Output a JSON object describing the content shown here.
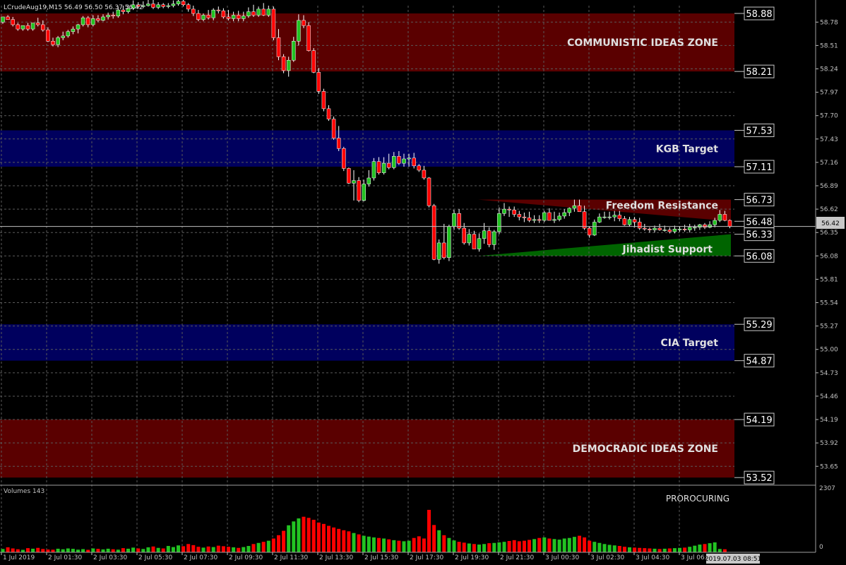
{
  "header": {
    "symbol_info": "LCrudeAug19,M15  56.49 56.50 56.37 56.42"
  },
  "colors": {
    "background": "#000000",
    "grid": "#5a5a5a",
    "bull": "#22c322",
    "bear": "#ff0000",
    "wick": "#ffffff",
    "red_zone": "#5a0000",
    "blue_zone": "#00005e",
    "triangle_red": "#5a0000",
    "triangle_green": "#006400",
    "text_light": "#e0e0e0",
    "price_box_border": "#c8c8c8"
  },
  "volume_panel": {
    "label": "Volumes 143",
    "indicator_label": "PROROCURING",
    "scale_top": "2307",
    "scale_bottom": "0"
  },
  "current_price_tag": "56.42",
  "timestamp_tag": "2019.07.03 08:51",
  "chart_data": {
    "type": "candlestick",
    "symbol": "LCrudeAug19",
    "timeframe": "M15",
    "ylim": [
      53.44,
      58.97
    ],
    "y_ticks": [
      "58.78",
      "58.51",
      "58.24",
      "57.97",
      "57.70",
      "57.43",
      "57.16",
      "56.89",
      "56.62",
      "56.35",
      "56.08",
      "55.81",
      "55.54",
      "55.27",
      "55.00",
      "54.73",
      "54.46",
      "54.19",
      "53.92",
      "53.65"
    ],
    "x_ticks": [
      "1 Jul 2019",
      "2 Jul 01:30",
      "2 Jul 03:30",
      "2 Jul 05:30",
      "2 Jul 07:30",
      "2 Jul 09:30",
      "2 Jul 11:30",
      "2 Jul 13:30",
      "2 Jul 15:30",
      "2 Jul 17:30",
      "2 Jul 19:30",
      "2 Jul 21:30",
      "3 Jul 00:30",
      "3 Jul 02:30",
      "3 Jul 04:30",
      "3 Jul 06:30"
    ],
    "candles": {
      "opens": [
        58.78,
        58.84,
        58.81,
        58.75,
        58.7,
        58.74,
        58.7,
        58.77,
        58.75,
        58.69,
        58.56,
        58.52,
        58.6,
        58.62,
        58.67,
        58.7,
        58.75,
        58.83,
        58.75,
        58.82,
        58.8,
        58.84,
        58.86,
        58.85,
        58.92,
        58.9,
        58.94,
        58.98,
        58.96,
        58.97,
        58.99,
        58.95,
        58.98,
        58.96,
        58.97,
        58.99,
        59.02,
        58.98,
        58.93,
        58.88,
        58.81,
        58.86,
        58.83,
        58.92,
        58.91,
        58.84,
        58.82,
        58.86,
        58.82,
        58.85,
        58.9,
        58.86,
        58.93,
        58.86,
        58.93,
        58.6,
        58.38,
        58.22,
        58.34,
        58.56,
        58.8,
        58.74,
        58.45,
        58.2,
        57.98,
        57.78,
        57.66,
        57.44,
        57.32,
        57.09,
        56.92,
        56.95,
        56.72,
        56.91,
        56.98,
        57.17,
        57.04,
        57.15,
        57.1,
        57.23,
        57.15,
        57.2,
        57.21,
        57.12,
        57.07,
        56.98,
        56.66,
        56.04,
        56.23,
        56.06,
        56.42,
        56.57,
        56.4,
        56.23,
        56.33,
        56.16,
        56.28,
        56.37,
        56.21,
        56.36,
        56.57,
        56.62,
        56.61,
        56.56,
        56.53,
        56.52,
        56.49,
        56.5,
        56.49,
        56.58,
        56.49,
        56.5,
        56.54,
        56.58,
        56.63,
        56.66,
        56.59,
        56.4,
        56.32,
        56.47,
        56.53,
        56.53,
        56.53,
        56.55,
        56.51,
        56.44,
        56.5,
        56.47,
        56.4,
        56.39,
        56.38,
        56.4,
        56.38,
        56.38,
        56.36,
        56.39,
        56.39,
        56.38,
        56.41,
        56.41,
        56.44,
        56.41,
        56.44,
        56.49,
        56.56,
        56.49
      ],
      "highs": [
        58.81,
        58.86,
        58.84,
        58.77,
        58.73,
        58.77,
        58.74,
        58.83,
        58.8,
        58.72,
        58.6,
        58.62,
        58.67,
        58.69,
        58.73,
        58.76,
        58.85,
        58.85,
        58.86,
        58.86,
        58.87,
        58.89,
        58.9,
        58.96,
        58.97,
        58.98,
        59.03,
        59.01,
        59.02,
        59.05,
        59.04,
        59.01,
        59.0,
        59.0,
        59.03,
        59.05,
        59.06,
        59.0,
        58.97,
        58.92,
        58.88,
        58.92,
        58.94,
        58.96,
        58.94,
        58.92,
        58.9,
        58.91,
        58.9,
        58.95,
        58.98,
        58.96,
        59.0,
        58.97,
        58.96,
        58.7,
        58.41,
        58.38,
        58.61,
        58.87,
        58.86,
        58.78,
        58.48,
        58.25,
        58.01,
        57.82,
        57.69,
        57.58,
        57.34,
        57.1,
        57.07,
        56.99,
        56.96,
        57.07,
        57.21,
        57.22,
        57.22,
        57.26,
        57.28,
        57.29,
        57.26,
        57.26,
        57.27,
        57.14,
        57.12,
        56.99,
        56.68,
        56.27,
        56.45,
        56.44,
        56.61,
        56.62,
        56.46,
        56.39,
        56.37,
        56.34,
        56.46,
        56.41,
        56.38,
        56.64,
        56.69,
        56.65,
        56.65,
        56.6,
        56.58,
        56.59,
        56.55,
        56.55,
        56.6,
        56.63,
        56.59,
        56.58,
        56.62,
        56.64,
        56.73,
        56.73,
        56.66,
        56.42,
        56.5,
        56.57,
        56.59,
        56.59,
        56.6,
        56.6,
        56.54,
        56.53,
        56.53,
        56.52,
        56.45,
        56.41,
        56.43,
        56.45,
        56.43,
        56.41,
        56.43,
        56.42,
        56.44,
        56.45,
        56.44,
        56.45,
        56.46,
        56.48,
        56.52,
        56.61,
        56.6,
        56.5
      ],
      "lows": [
        58.76,
        58.81,
        58.73,
        58.68,
        58.68,
        58.68,
        58.68,
        58.73,
        58.67,
        58.55,
        58.5,
        58.49,
        58.57,
        58.6,
        58.64,
        58.65,
        58.73,
        58.72,
        58.73,
        58.78,
        58.79,
        58.81,
        58.82,
        58.83,
        58.87,
        58.88,
        58.92,
        58.94,
        58.94,
        58.96,
        58.93,
        58.93,
        58.94,
        58.94,
        58.95,
        58.97,
        58.96,
        58.9,
        58.85,
        58.79,
        58.79,
        58.81,
        58.8,
        58.88,
        58.82,
        58.8,
        58.79,
        58.79,
        58.79,
        58.83,
        58.84,
        58.84,
        58.85,
        58.84,
        58.57,
        58.34,
        58.19,
        58.15,
        58.32,
        58.51,
        58.71,
        58.44,
        58.19,
        57.95,
        57.75,
        57.64,
        57.42,
        57.29,
        57.06,
        56.91,
        56.72,
        56.7,
        56.71,
        56.88,
        56.95,
        57.02,
        57.02,
        57.08,
        57.08,
        57.13,
        57.11,
        57.11,
        57.09,
        57.05,
        56.96,
        56.64,
        56.03,
        55.99,
        56.04,
        56.02,
        56.38,
        56.38,
        56.21,
        56.2,
        56.16,
        56.13,
        56.22,
        56.18,
        56.15,
        56.33,
        56.54,
        56.53,
        56.53,
        56.49,
        56.47,
        56.47,
        56.46,
        56.46,
        56.47,
        56.49,
        56.46,
        56.48,
        56.51,
        56.54,
        56.59,
        56.59,
        56.38,
        56.29,
        56.31,
        56.46,
        56.51,
        56.5,
        56.48,
        56.48,
        56.43,
        56.42,
        56.41,
        56.38,
        56.37,
        56.35,
        56.35,
        56.37,
        56.36,
        56.34,
        56.34,
        56.36,
        56.36,
        56.35,
        56.37,
        56.38,
        56.39,
        56.4,
        56.41,
        56.47,
        56.48,
        56.4
      ],
      "closes": [
        58.84,
        58.81,
        58.75,
        58.7,
        58.74,
        58.7,
        58.77,
        58.75,
        58.69,
        58.56,
        58.52,
        58.6,
        58.62,
        58.67,
        58.7,
        58.75,
        58.83,
        58.75,
        58.82,
        58.8,
        58.84,
        58.86,
        58.85,
        58.92,
        58.9,
        58.94,
        58.98,
        58.96,
        58.97,
        58.99,
        58.95,
        58.98,
        58.96,
        58.97,
        58.99,
        59.02,
        58.98,
        58.93,
        58.88,
        58.81,
        58.86,
        58.83,
        58.92,
        58.91,
        58.84,
        58.82,
        58.86,
        58.82,
        58.85,
        58.9,
        58.86,
        58.93,
        58.86,
        58.93,
        58.6,
        58.38,
        58.22,
        58.34,
        58.56,
        58.8,
        58.74,
        58.45,
        58.2,
        57.98,
        57.78,
        57.66,
        57.44,
        57.32,
        57.09,
        56.92,
        56.95,
        56.72,
        56.91,
        56.98,
        57.17,
        57.04,
        57.15,
        57.1,
        57.23,
        57.15,
        57.2,
        57.21,
        57.12,
        57.07,
        56.98,
        56.66,
        56.04,
        56.23,
        56.06,
        56.42,
        56.57,
        56.4,
        56.23,
        56.33,
        56.16,
        56.28,
        56.37,
        56.21,
        56.36,
        56.57,
        56.62,
        56.61,
        56.56,
        56.53,
        56.52,
        56.49,
        56.5,
        56.49,
        56.58,
        56.49,
        56.5,
        56.54,
        56.58,
        56.63,
        56.66,
        56.59,
        56.4,
        56.32,
        56.47,
        56.53,
        56.53,
        56.53,
        56.55,
        56.51,
        56.44,
        56.5,
        56.47,
        56.4,
        56.39,
        56.38,
        56.4,
        56.38,
        56.38,
        56.36,
        56.39,
        56.39,
        56.38,
        56.41,
        56.41,
        56.44,
        56.41,
        56.44,
        56.49,
        56.56,
        56.49,
        56.42
      ]
    },
    "volumes": [
      120,
      180,
      140,
      110,
      90,
      150,
      130,
      160,
      120,
      100,
      95,
      130,
      110,
      140,
      125,
      95,
      115,
      90,
      140,
      125,
      105,
      130,
      110,
      95,
      150,
      130,
      170,
      140,
      120,
      180,
      210,
      160,
      140,
      230,
      190,
      250,
      220,
      300,
      260,
      200,
      170,
      210,
      190,
      240,
      220,
      200,
      180,
      160,
      190,
      230,
      300,
      340,
      380,
      420,
      500,
      620,
      780,
      980,
      1120,
      1230,
      1290,
      1250,
      1180,
      1080,
      1030,
      960,
      900,
      850,
      800,
      760,
      700,
      650,
      600,
      570,
      540,
      520,
      500,
      470,
      440,
      420,
      400,
      420,
      520,
      580,
      500,
      1540,
      990,
      800,
      620,
      520,
      430,
      380,
      350,
      320,
      300,
      280,
      300,
      330,
      340,
      360,
      380,
      410,
      440,
      400,
      420,
      450,
      480,
      520,
      540,
      500,
      480,
      460,
      500,
      520,
      560,
      600,
      540,
      420,
      380,
      340,
      300,
      270,
      250,
      230,
      200,
      180,
      170,
      160,
      150,
      140,
      130,
      120,
      130,
      140,
      150,
      160,
      170,
      200,
      240,
      280,
      300,
      330,
      360,
      120,
      110
    ],
    "levels": [
      {
        "label": "COMMUNISTIC IDEAS ZONE",
        "top": 58.88,
        "bottom": 58.21,
        "color": "red_zone"
      },
      {
        "label": "KGB Target",
        "top": 57.53,
        "bottom": 57.11,
        "color": "blue_zone"
      },
      {
        "label": "CIA Target",
        "top": 55.29,
        "bottom": 54.87,
        "color": "blue_zone"
      },
      {
        "label": "DEMOCRADIC IDEAS ZONE",
        "top": 54.19,
        "bottom": 53.52,
        "color": "red_zone"
      }
    ],
    "triangles": [
      {
        "label": "Freedom Resistance",
        "top": 56.73,
        "bottom": 56.48,
        "color": "triangle_red"
      },
      {
        "label": "Jihadist Support",
        "top": 56.33,
        "bottom": 56.08,
        "color": "triangle_green"
      }
    ],
    "price_tags": [
      "58.88",
      "58.21",
      "57.53",
      "57.11",
      "56.73",
      "56.48",
      "56.33",
      "56.08",
      "55.29",
      "54.87",
      "54.19",
      "53.52"
    ]
  }
}
